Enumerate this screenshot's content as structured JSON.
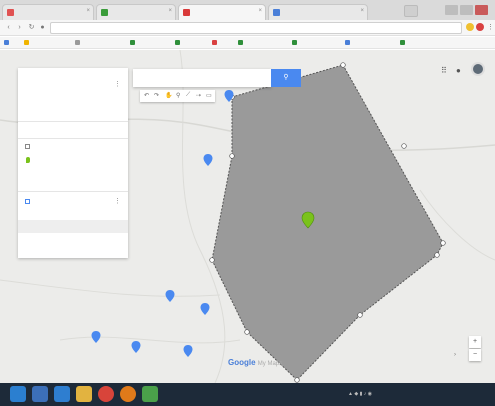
{
  "browser": {
    "tabs": [
      {
        "label": "",
        "fav_color": "#e05252"
      },
      {
        "label": "",
        "fav_color": "#3a9c3a"
      },
      {
        "label": "",
        "fav_color": "#d93a3a"
      },
      {
        "label": "",
        "fav_color": "#4a7fd8"
      }
    ],
    "url": "",
    "bookmarks": [
      {
        "label": "",
        "color": "#4a7fd8"
      },
      {
        "label": "",
        "color": "#f0b400"
      },
      {
        "label": "",
        "color": "#9a9a9a"
      },
      {
        "label": "",
        "color": "#2f8f3a"
      },
      {
        "label": "",
        "color": "#2f8f3a"
      },
      {
        "label": "",
        "color": "#d94141"
      },
      {
        "label": "",
        "color": "#2f8f3a"
      },
      {
        "label": "",
        "color": "#2f8f3a"
      },
      {
        "label": "",
        "color": "#4a7fd8"
      },
      {
        "label": "",
        "color": "#2f8f3a"
      }
    ]
  },
  "map_panel": {
    "title": "",
    "description": "",
    "actions": "",
    "layer1_name": "",
    "layer1_item": "",
    "layer2_name": "",
    "layer2_add": "",
    "untitled_label": "",
    "base_map": ""
  },
  "search": {
    "button_icon": "search-icon"
  },
  "map": {
    "polygon_fill": "#9a9a9a",
    "pin_color": "#7ac21b",
    "labels": {
      "place1": "",
      "place2": "",
      "place3": "",
      "place4": ""
    },
    "google_logo": "Google",
    "google_suffix": "My Maps",
    "copyright": ""
  },
  "top_right": {
    "apps_icon": "apps-icon",
    "menu_icon": "more-icon"
  },
  "zoom": {
    "plus": "+",
    "minus": "−"
  },
  "taskbar": {
    "icons": [
      {
        "name": "start-icon",
        "color": "#2b7fd0"
      },
      {
        "name": "explorer-icon",
        "color": "#3c6fb8"
      },
      {
        "name": "edge-icon",
        "color": "#2e7ed0"
      },
      {
        "name": "files-icon",
        "color": "#e2b340"
      },
      {
        "name": "chrome-icon",
        "color": "#d8443a"
      },
      {
        "name": "firefox-icon",
        "color": "#e07a1a"
      },
      {
        "name": "app-icon",
        "color": "#4aa04a"
      }
    ],
    "time": "",
    "date": ""
  }
}
